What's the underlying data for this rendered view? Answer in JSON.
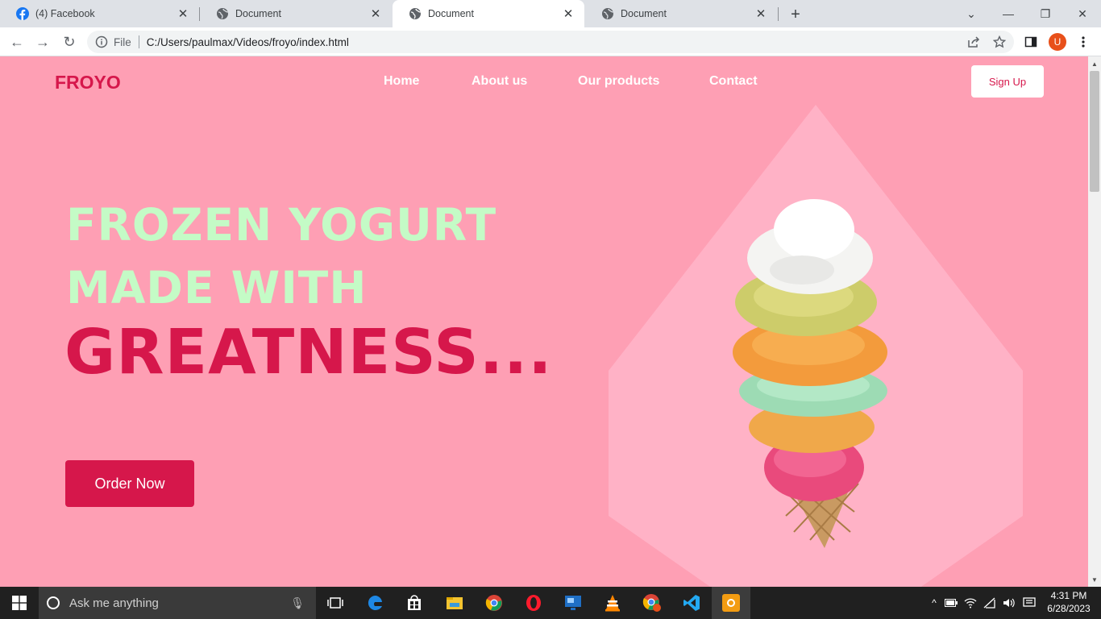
{
  "browser": {
    "tabs": [
      {
        "label": "(4) Facebook",
        "icon": "facebook-icon"
      },
      {
        "label": "Document",
        "icon": "globe-icon"
      },
      {
        "label": "Document",
        "icon": "globe-icon",
        "active": true
      },
      {
        "label": "Document",
        "icon": "globe-icon"
      }
    ],
    "url_scheme_label": "File",
    "url": "C:/Users/paulmax/Videos/froyo/index.html",
    "profile_initial": "U"
  },
  "site": {
    "logo": "FROYO",
    "nav": [
      "Home",
      "About us",
      "Our products",
      "Contact"
    ],
    "signup_label": "Sign Up",
    "hero_line1": "FROZEN YOGURT",
    "hero_line2": "MADE WITH",
    "hero_line3": "GREATNESS...",
    "order_label": "Order Now",
    "colors": {
      "background": "#fe9fb4",
      "accent": "#d6174b",
      "mint": "#c4fbc6",
      "shape": "#ffb2c6"
    }
  },
  "taskbar": {
    "search_placeholder": "Ask me anything",
    "apps": [
      "task-view-icon",
      "edge-icon",
      "store-icon",
      "file-explorer-icon",
      "chrome-icon",
      "opera-icon",
      "remote-desktop-icon",
      "vlc-icon",
      "chrome-profile-icon",
      "vscode-icon",
      "recorder-icon"
    ],
    "time": "4:31 PM",
    "date": "6/28/2023"
  }
}
